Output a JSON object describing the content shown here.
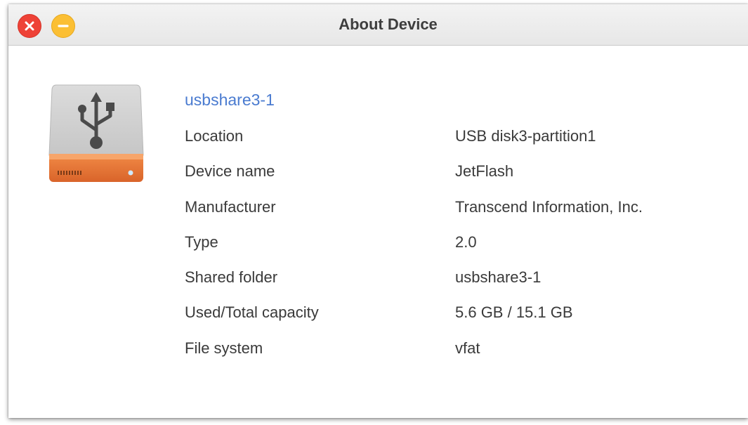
{
  "window": {
    "title": "About Device"
  },
  "controls": {
    "close_icon": "close-icon",
    "minimize_icon": "minimize-icon",
    "close_color": "#ee4237",
    "minimize_color": "#fbbf34"
  },
  "device": {
    "icon": "usb-drive-icon",
    "name": "usbshare3-1",
    "name_color": "#4a7bd0",
    "accent_color": "#ef7a3c"
  },
  "info": [
    {
      "label": "Location",
      "value": "USB disk3-partition1"
    },
    {
      "label": "Device name",
      "value": "JetFlash"
    },
    {
      "label": "Manufacturer",
      "value": "Transcend Information, Inc."
    },
    {
      "label": "Type",
      "value": "2.0"
    },
    {
      "label": "Shared folder",
      "value": "usbshare3-1"
    },
    {
      "label": "Used/Total capacity",
      "value": "5.6 GB / 15.1 GB"
    },
    {
      "label": "File system",
      "value": "vfat"
    }
  ]
}
